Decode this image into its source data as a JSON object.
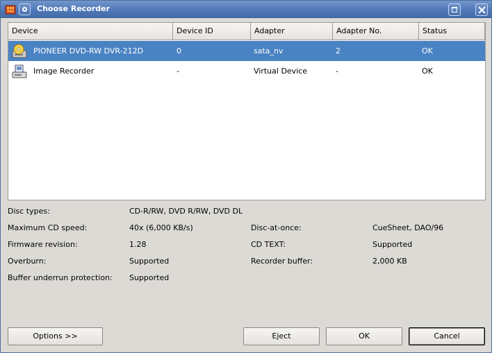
{
  "window": {
    "title": "Choose Recorder"
  },
  "icons": {
    "app": "k3b-app-icon",
    "menu": "window-menu-icon",
    "maximize": "maximize-icon",
    "close": "close-icon",
    "drive": "cd-drive-icon",
    "image": "image-recorder-icon"
  },
  "colors": {
    "titlebar": "#5078b8",
    "selection": "#4a83c3"
  },
  "table": {
    "columns": [
      "Device",
      "Device ID",
      "Adapter",
      "Adapter No.",
      "Status"
    ],
    "rows": [
      {
        "device": "PIONEER  DVD-RW  DVR-212D",
        "device_id": "0",
        "adapter": "sata_nv",
        "adapter_no": "2",
        "status": "OK"
      },
      {
        "device": "Image Recorder",
        "device_id": "-",
        "adapter": "Virtual Device",
        "adapter_no": "-",
        "status": "OK"
      }
    ]
  },
  "details": {
    "disc_types_label": "Disc types:",
    "disc_types_value": "CD-R/RW, DVD R/RW, DVD DL",
    "max_speed_label": "Maximum CD speed:",
    "max_speed_value": "40x (6,000 KB/s)",
    "disc_at_once_label": "Disc-at-once:",
    "disc_at_once_value": "CueSheet, DAO/96",
    "firmware_label": "Firmware revision:",
    "firmware_value": "1.28",
    "cd_text_label": "CD TEXT:",
    "cd_text_value": "Supported",
    "overburn_label": "Overburn:",
    "overburn_value": "Supported",
    "buffer_label": "Recorder buffer:",
    "buffer_value": "2,000 KB",
    "underrun_label": "Buffer underrun protection:",
    "underrun_value": "Supported"
  },
  "buttons": {
    "options": "Options >>",
    "eject": "Eject",
    "ok": "OK",
    "cancel": "Cancel"
  }
}
